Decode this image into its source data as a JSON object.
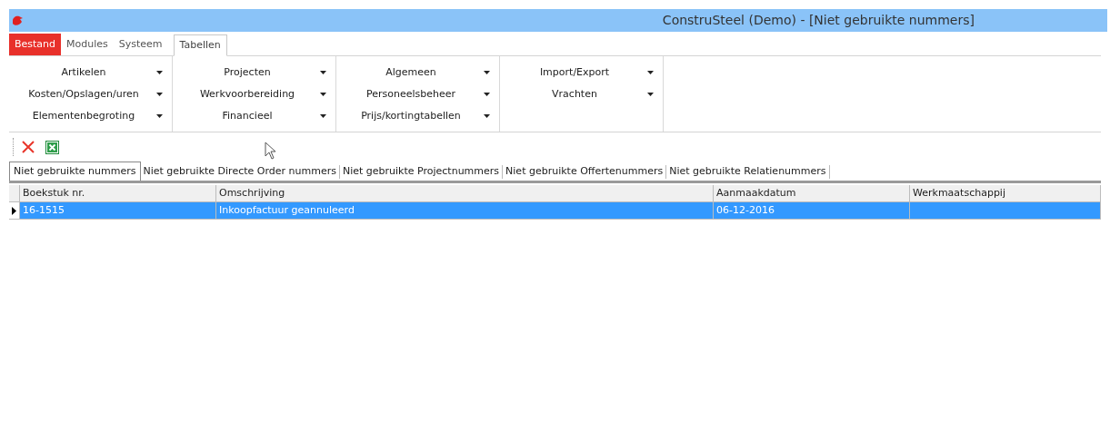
{
  "window": {
    "title": "ConstruSteel (Demo) - [Niet gebruikte nummers]"
  },
  "menu_tabs": [
    {
      "label": "Bestand",
      "kind": "file",
      "selected": false
    },
    {
      "label": "Modules",
      "kind": "tab",
      "selected": false
    },
    {
      "label": "Systeem",
      "kind": "tab",
      "selected": false
    },
    {
      "label": "Tabellen",
      "kind": "tab",
      "selected": true
    }
  ],
  "ribbon_groups": [
    {
      "items": [
        "Artikelen",
        "Kosten/Opslagen/uren",
        "Elementenbegroting"
      ]
    },
    {
      "items": [
        "Projecten",
        "Werkvoorbereiding",
        "Financieel"
      ]
    },
    {
      "items": [
        "Algemeen",
        "Personeelsbeheer",
        "Prijs/kortingtabellen"
      ]
    },
    {
      "items": [
        "Import/Export",
        "Vrachten"
      ]
    }
  ],
  "toolbar": [
    {
      "kind": "delete"
    },
    {
      "kind": "excel"
    }
  ],
  "tabs": [
    {
      "label": "Niet gebruikte nummers",
      "selected": true
    },
    {
      "label": "Niet gebruikte Directe Order nummers",
      "selected": false
    },
    {
      "label": "Niet gebruikte Projectnummers",
      "selected": false
    },
    {
      "label": "Niet gebruikte Offertenummers",
      "selected": false
    },
    {
      "label": "Niet gebruikte Relatienummers",
      "selected": false
    }
  ],
  "table": {
    "columns": [
      "Boekstuk nr.",
      "Omschrijving",
      "Aanmaakdatum",
      "Werkmaatschappij"
    ],
    "rows": [
      {
        "cells": [
          "16-1515",
          "Inkoopfactuur geannuleerd",
          "06-12-2016",
          ""
        ],
        "selected": true,
        "current": true
      }
    ]
  }
}
